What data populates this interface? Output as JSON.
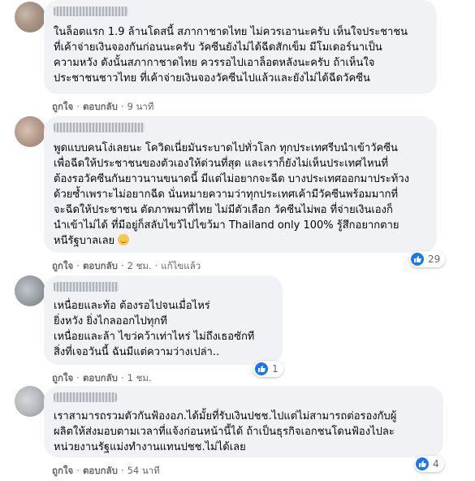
{
  "actions": {
    "like": "ถูกใจ",
    "reply": "ตอบกลับ",
    "edited": "แก้ไขแล้ว",
    "separator": "·"
  },
  "comments": [
    {
      "text": "ในล็อตแรก 1.9 ล้านโดสนี้ สภากาชาดไทย ไม่ควรเอานะครับ เห็นใจประชาชน\nที่เค้าจ่ายเงินจองกันก่อนนะครับ วัคซีนยังไม่ได้ฉีดสักเข็ม มีโมเดอร์นาเป็น\nความหวัง ดังนั้นสภากาชาดไทย ควรรอไปเอาล็อตหลังนะครับ ถ้าเห็นใจ\nประชาชนชาวไทย ที่เค้าจ่ายเงินจองวัคซีนไปแล้วและยังไม่ได้ฉีดวัคซีน",
      "time": "9 นาที"
    },
    {
      "text": "พูดแบบคนโง่เลยนะ โควิดเนี่ยมันระบาดไปทั่วโลก ทุกประเทศรีบนำเข้าวัคซีน\nเพื่อฉีดให้ประชาชนของตัวเองให้ด่วนที่สุด และเราก็ยังไม่เห็นประเทศไหนที่\nต้องรอวัคซีนกันยาวนานขนาดนี้ มีแต่ไม่อยากจะฉีด บางประเทศออกมาประท้วง\nด้วยซ้ำเพราะไม่อยากฉีด นั่นหมายความว่าทุกประเทศเค้ามีวัคซีนพร้อมมากที่\nจะฉีดให้ประชาชน ตัดภาพมาที่ไทย ไม่มีตัวเลือก วัคซีนไม่พอ ที่จ่ายเงินเองก็\nนำเข้าไม่ได้ ที่มีอยู่ก็สลับไขว้ไปไขว้มา Thailand only 100% รู้สึกอยากตาย\nหนีรัฐบาลเลย",
      "time": "2 ชม.",
      "reaction_count": "29"
    },
    {
      "text": "เหนื่อยและท้อ ต้องรอไปจนเมื่อไหร่\nยิ่งหวัง ยิ่งไกลออกไปทุกที\nเหนื่อยและล้า ไขว่คว้าเท่าไหร่ ไม่ถึงเธอซักที\nสิ่งที่เจอวันนี้ ฉันมีแต่ความว่างเปล่า..",
      "time": "1 ชม.",
      "reaction_count": "1"
    },
    {
      "text": "เราสามารถรวมตัวกันฟ้องอภ.ได้มั้ยที่รับเงินปชช.ไปแต่ไม่สามารถต่อรองกับผู้\nผลิตให้ส่งมอบตามเวลาที่แจ้งก่อนหน้านี้ได้ ถ้าเป็นธุรกิจเอกชนโดนฟ้องไปละ\nหน่วยงานรัฐแม่งทำงานแทนปชช.ไม่ได้เลย",
      "time": "54 นาที",
      "reaction_count": "4"
    }
  ]
}
